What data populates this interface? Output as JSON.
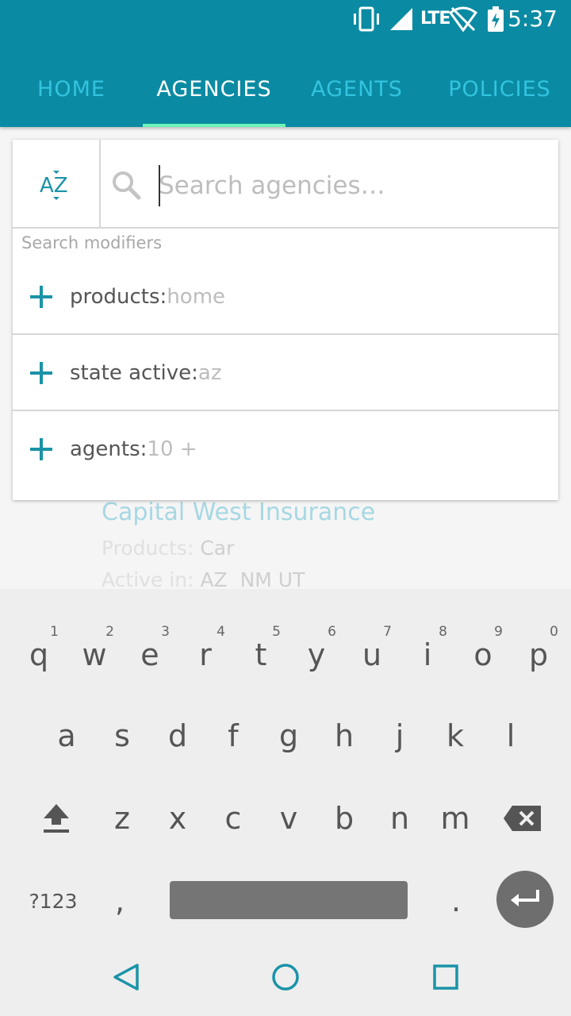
{
  "status_bar": {
    "time": "5:37",
    "network_label": "LTE",
    "icons": [
      "vibrate-icon",
      "signal-icon",
      "wifi-off-icon",
      "battery-charging-icon"
    ]
  },
  "tabs": [
    {
      "label": "HOME",
      "active": false
    },
    {
      "label": "AGENCIES",
      "active": true
    },
    {
      "label": "AGENTS",
      "active": false
    },
    {
      "label": "POLICIES",
      "active": false
    }
  ],
  "search": {
    "sort_button_label": "AZ",
    "placeholder": "Search agencies…",
    "value": "",
    "modifiers_caption": "Search modifiers",
    "modifiers": [
      {
        "label": "products:",
        "hint": "home"
      },
      {
        "label": "state active:",
        "hint": "az"
      },
      {
        "label": "agents:",
        "hint": "10 +"
      }
    ]
  },
  "agency_card": {
    "name": "Capital West Insurance",
    "products_label": "Products:",
    "products_value": "Car",
    "active_label": "Active in:",
    "active_value": "AZ  NM UT"
  },
  "keyboard": {
    "row1": [
      {
        "key": "q",
        "hint": "1"
      },
      {
        "key": "w",
        "hint": "2"
      },
      {
        "key": "e",
        "hint": "3"
      },
      {
        "key": "r",
        "hint": "4"
      },
      {
        "key": "t",
        "hint": "5"
      },
      {
        "key": "y",
        "hint": "6"
      },
      {
        "key": "u",
        "hint": "7"
      },
      {
        "key": "i",
        "hint": "8"
      },
      {
        "key": "o",
        "hint": "9"
      },
      {
        "key": "p",
        "hint": "0"
      }
    ],
    "row2": [
      "a",
      "s",
      "d",
      "f",
      "g",
      "h",
      "j",
      "k",
      "l"
    ],
    "row3": [
      "z",
      "x",
      "c",
      "v",
      "b",
      "n",
      "m"
    ],
    "symbols_label": "?123",
    "comma": ",",
    "period": "."
  },
  "colors": {
    "primary": "#0a8ba3",
    "tab_inactive": "#33c3df",
    "tab_indicator": "#6ff2b8",
    "accent": "#1a93a8"
  }
}
